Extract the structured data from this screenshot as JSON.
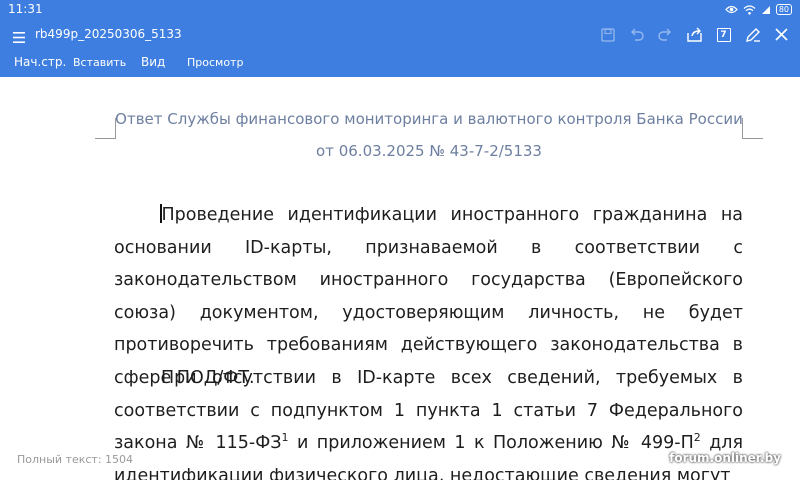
{
  "status_bar": {
    "time": "11:31",
    "battery": "80"
  },
  "toolbar": {
    "doc_title": "rb499p_20250306_5133",
    "page_badge": "7"
  },
  "tabs": [
    "Нач.стр.",
    "Вставить",
    "Вид",
    "Просмотр"
  ],
  "document": {
    "header_line1": "Ответ Службы финансового мониторинга и валютного контроля Банка России",
    "header_line2": "от 06.03.2025 № 43-7-2/5133",
    "paragraph1": "Проведение идентификации иностранного гражданина на основании ID-карты, признаваемой в соответствии с законодательством иностранного государства (Европейского союза) документом, удостоверяющим личность, не будет противоречить требованиям действующего законодательства в сфере ПОД/ФТ.",
    "paragraph2_part1": "При отсутствии в ID-карте всех сведений, требуемых в соответствии с подпунктом 1 пункта 1 статьи 7 Федерального закона № 115-ФЗ",
    "footnote1": "1",
    "paragraph2_part2": " и приложением 1 к Положению № 499-П",
    "footnote2": "2",
    "paragraph2_part3": " для идентификации физического лица, недостающие сведения могут"
  },
  "footer": {
    "word_count": "Полный текст: 1504",
    "watermark": "forum.onliner.by"
  },
  "colors": {
    "accent": "#3d7ee0",
    "header_text": "#6d7fa0",
    "body_text": "#1e1e1e"
  }
}
